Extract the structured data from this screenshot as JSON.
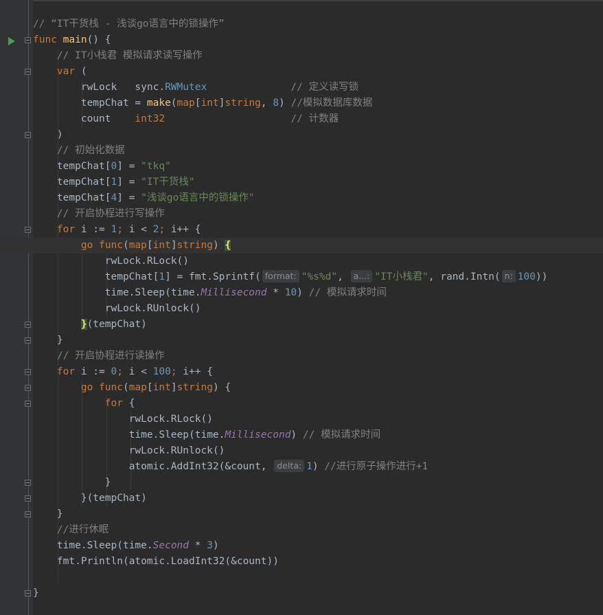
{
  "lines": [
    {
      "tokens": [
        {
          "c": "cmt",
          "t": "// “IT干货栈 - 浅谈go语言中的锁操作”"
        }
      ]
    },
    {
      "tokens": [
        {
          "c": "kw",
          "t": "func "
        },
        {
          "c": "fn",
          "t": "main"
        },
        {
          "c": "",
          "t": "() {"
        }
      ]
    },
    {
      "tokens": [
        {
          "c": "",
          "t": "    "
        },
        {
          "c": "cmt",
          "t": "// IT小栈君 模拟请求读写操作"
        }
      ]
    },
    {
      "tokens": [
        {
          "c": "",
          "t": "    "
        },
        {
          "c": "kw",
          "t": "var "
        },
        {
          "c": "",
          "t": "("
        }
      ]
    },
    {
      "tokens": [
        {
          "c": "",
          "t": "        rwLock   "
        },
        {
          "c": "pkg",
          "t": "sync."
        },
        {
          "c": "call",
          "t": "RWMutex"
        },
        {
          "c": "",
          "t": "              "
        },
        {
          "c": "cmt",
          "t": "// 定义读写锁"
        }
      ]
    },
    {
      "tokens": [
        {
          "c": "",
          "t": "        tempChat = "
        },
        {
          "c": "fn",
          "t": "make"
        },
        {
          "c": "",
          "t": "("
        },
        {
          "c": "kw",
          "t": "map"
        },
        {
          "c": "",
          "t": "["
        },
        {
          "c": "kw",
          "t": "int"
        },
        {
          "c": "",
          "t": "]"
        },
        {
          "c": "kw",
          "t": "string"
        },
        {
          "c": "",
          "t": ", "
        },
        {
          "c": "num",
          "t": "8"
        },
        {
          "c": "",
          "t": ") "
        },
        {
          "c": "cmt",
          "t": "//模拟数据库数据"
        }
      ]
    },
    {
      "tokens": [
        {
          "c": "",
          "t": "        count    "
        },
        {
          "c": "kw",
          "t": "int32"
        },
        {
          "c": "",
          "t": "                     "
        },
        {
          "c": "cmt",
          "t": "// 计数器"
        }
      ]
    },
    {
      "tokens": [
        {
          "c": "",
          "t": "    )"
        }
      ]
    },
    {
      "tokens": [
        {
          "c": "",
          "t": "    "
        },
        {
          "c": "cmt",
          "t": "// 初始化数据"
        }
      ]
    },
    {
      "tokens": [
        {
          "c": "",
          "t": "    tempChat["
        },
        {
          "c": "num",
          "t": "0"
        },
        {
          "c": "",
          "t": "] = "
        },
        {
          "c": "str",
          "t": "\"tkq\""
        }
      ]
    },
    {
      "tokens": [
        {
          "c": "",
          "t": "    tempChat["
        },
        {
          "c": "num",
          "t": "1"
        },
        {
          "c": "",
          "t": "] = "
        },
        {
          "c": "str",
          "t": "\"IT干货栈\""
        }
      ]
    },
    {
      "tokens": [
        {
          "c": "",
          "t": "    tempChat["
        },
        {
          "c": "num",
          "t": "4"
        },
        {
          "c": "",
          "t": "] = "
        },
        {
          "c": "str",
          "t": "\"浅谈go语言中的锁操作\""
        }
      ]
    },
    {
      "tokens": [
        {
          "c": "",
          "t": "    "
        },
        {
          "c": "cmt",
          "t": "// 开启协程进行写操作"
        }
      ]
    },
    {
      "tokens": [
        {
          "c": "",
          "t": "    "
        },
        {
          "c": "kw",
          "t": "for "
        },
        {
          "c": "",
          "t": "i := "
        },
        {
          "c": "num",
          "t": "1"
        },
        {
          "c": "kw",
          "t": "; "
        },
        {
          "c": "",
          "t": "i < "
        },
        {
          "c": "num",
          "t": "2"
        },
        {
          "c": "kw",
          "t": "; "
        },
        {
          "c": "",
          "t": "i++ {"
        }
      ]
    },
    {
      "highlight": true,
      "tokens": [
        {
          "c": "",
          "t": "        "
        },
        {
          "c": "kw",
          "t": "go "
        },
        {
          "c": "kw",
          "t": "func"
        },
        {
          "c": "",
          "t": "("
        },
        {
          "c": "kw",
          "t": "map"
        },
        {
          "c": "",
          "t": "["
        },
        {
          "c": "kw",
          "t": "int"
        },
        {
          "c": "",
          "t": "]"
        },
        {
          "c": "kw",
          "t": "string"
        },
        {
          "c": "",
          "t": ") "
        },
        {
          "c": "brace-match",
          "t": "{"
        }
      ]
    },
    {
      "tokens": [
        {
          "c": "",
          "t": "            rwLock."
        },
        {
          "c": "mth",
          "t": "RLock"
        },
        {
          "c": "",
          "t": "()"
        }
      ]
    },
    {
      "tokens": [
        {
          "c": "",
          "t": "            tempChat["
        },
        {
          "c": "num",
          "t": "1"
        },
        {
          "c": "",
          "t": "] = "
        },
        {
          "c": "pkg",
          "t": "fmt."
        },
        {
          "c": "mth",
          "t": "Sprintf"
        },
        {
          "c": "",
          "t": "("
        },
        {
          "c": "hint",
          "t": "format:"
        },
        {
          "c": "str",
          "t": "\"%s%d\""
        },
        {
          "c": "",
          "t": ", "
        },
        {
          "c": "hint",
          "t": "a...:"
        },
        {
          "c": "str",
          "t": "\"IT小栈君\""
        },
        {
          "c": "",
          "t": ", "
        },
        {
          "c": "pkg",
          "t": "rand."
        },
        {
          "c": "mth",
          "t": "Intn"
        },
        {
          "c": "",
          "t": "("
        },
        {
          "c": "hint",
          "t": "n:"
        },
        {
          "c": "num",
          "t": "100"
        },
        {
          "c": "",
          "t": "))"
        }
      ]
    },
    {
      "tokens": [
        {
          "c": "",
          "t": "            "
        },
        {
          "c": "pkg",
          "t": "time."
        },
        {
          "c": "mth",
          "t": "Sleep"
        },
        {
          "c": "",
          "t": "("
        },
        {
          "c": "pkg",
          "t": "time."
        },
        {
          "c": "ital",
          "t": "Millisecond"
        },
        {
          "c": "",
          "t": " * "
        },
        {
          "c": "num",
          "t": "10"
        },
        {
          "c": "",
          "t": ") "
        },
        {
          "c": "cmt",
          "t": "// 模拟请求时间"
        }
      ]
    },
    {
      "tokens": [
        {
          "c": "",
          "t": "            rwLock."
        },
        {
          "c": "mth",
          "t": "RUnlock"
        },
        {
          "c": "",
          "t": "()"
        }
      ]
    },
    {
      "tokens": [
        {
          "c": "",
          "t": "        "
        },
        {
          "c": "brace-match",
          "t": "}"
        },
        {
          "c": "",
          "t": "(tempChat)"
        }
      ]
    },
    {
      "tokens": [
        {
          "c": "",
          "t": "    }"
        }
      ]
    },
    {
      "tokens": [
        {
          "c": "",
          "t": "    "
        },
        {
          "c": "cmt",
          "t": "// 开启协程进行读操作"
        }
      ]
    },
    {
      "tokens": [
        {
          "c": "",
          "t": "    "
        },
        {
          "c": "kw",
          "t": "for "
        },
        {
          "c": "",
          "t": "i := "
        },
        {
          "c": "num",
          "t": "0"
        },
        {
          "c": "kw",
          "t": "; "
        },
        {
          "c": "",
          "t": "i < "
        },
        {
          "c": "num",
          "t": "100"
        },
        {
          "c": "kw",
          "t": "; "
        },
        {
          "c": "",
          "t": "i++ {"
        }
      ]
    },
    {
      "tokens": [
        {
          "c": "",
          "t": "        "
        },
        {
          "c": "kw",
          "t": "go "
        },
        {
          "c": "kw",
          "t": "func"
        },
        {
          "c": "",
          "t": "("
        },
        {
          "c": "kw",
          "t": "map"
        },
        {
          "c": "",
          "t": "["
        },
        {
          "c": "kw",
          "t": "int"
        },
        {
          "c": "",
          "t": "]"
        },
        {
          "c": "kw",
          "t": "string"
        },
        {
          "c": "",
          "t": ") {"
        }
      ]
    },
    {
      "tokens": [
        {
          "c": "",
          "t": "            "
        },
        {
          "c": "kw",
          "t": "for "
        },
        {
          "c": "",
          "t": "{"
        }
      ]
    },
    {
      "tokens": [
        {
          "c": "",
          "t": "                rwLock."
        },
        {
          "c": "mth",
          "t": "RLock"
        },
        {
          "c": "",
          "t": "()"
        }
      ]
    },
    {
      "tokens": [
        {
          "c": "",
          "t": "                "
        },
        {
          "c": "pkg",
          "t": "time."
        },
        {
          "c": "mth",
          "t": "Sleep"
        },
        {
          "c": "",
          "t": "("
        },
        {
          "c": "pkg",
          "t": "time."
        },
        {
          "c": "ital",
          "t": "Millisecond"
        },
        {
          "c": "",
          "t": ") "
        },
        {
          "c": "cmt",
          "t": "// 模拟请求时间"
        }
      ]
    },
    {
      "tokens": [
        {
          "c": "",
          "t": "                rwLock."
        },
        {
          "c": "mth",
          "t": "RUnlock"
        },
        {
          "c": "",
          "t": "()"
        }
      ]
    },
    {
      "tokens": [
        {
          "c": "",
          "t": "                "
        },
        {
          "c": "pkg",
          "t": "atomic."
        },
        {
          "c": "mth",
          "t": "AddInt32"
        },
        {
          "c": "",
          "t": "(&count, "
        },
        {
          "c": "hint",
          "t": "delta:"
        },
        {
          "c": "num",
          "t": "1"
        },
        {
          "c": "",
          "t": ") "
        },
        {
          "c": "cmt",
          "t": "//进行原子操作进行+1"
        }
      ]
    },
    {
      "tokens": [
        {
          "c": "",
          "t": "            }"
        }
      ]
    },
    {
      "tokens": [
        {
          "c": "",
          "t": "        }(tempChat)"
        }
      ]
    },
    {
      "tokens": [
        {
          "c": "",
          "t": "    }"
        }
      ]
    },
    {
      "tokens": [
        {
          "c": "",
          "t": "    "
        },
        {
          "c": "cmt",
          "t": "//进行休眠"
        }
      ]
    },
    {
      "tokens": [
        {
          "c": "",
          "t": "    "
        },
        {
          "c": "pkg",
          "t": "time."
        },
        {
          "c": "mth",
          "t": "Sleep"
        },
        {
          "c": "",
          "t": "("
        },
        {
          "c": "pkg",
          "t": "time."
        },
        {
          "c": "ital",
          "t": "Second"
        },
        {
          "c": "",
          "t": " * "
        },
        {
          "c": "num",
          "t": "3"
        },
        {
          "c": "",
          "t": ")"
        }
      ]
    },
    {
      "tokens": [
        {
          "c": "",
          "t": "    "
        },
        {
          "c": "pkg",
          "t": "fmt."
        },
        {
          "c": "mth",
          "t": "Println"
        },
        {
          "c": "",
          "t": "("
        },
        {
          "c": "pkg",
          "t": "atomic."
        },
        {
          "c": "mth",
          "t": "LoadInt32"
        },
        {
          "c": "",
          "t": "(&count))"
        }
      ]
    },
    {
      "tokens": [
        {
          "c": "",
          "t": ""
        }
      ]
    },
    {
      "tokens": [
        {
          "c": "",
          "t": "}"
        }
      ]
    }
  ],
  "colors": {
    "background": "#2b2b2b",
    "gutter": "#313335",
    "keyword": "#cc7832",
    "function": "#ffc66d",
    "string": "#6a8759",
    "number": "#6897bb",
    "comment": "#808080",
    "constant": "#9876aa",
    "run_icon": "#499c54"
  },
  "icons": {
    "run": "run-arrow-icon",
    "fold": "fold-marker-icon"
  }
}
